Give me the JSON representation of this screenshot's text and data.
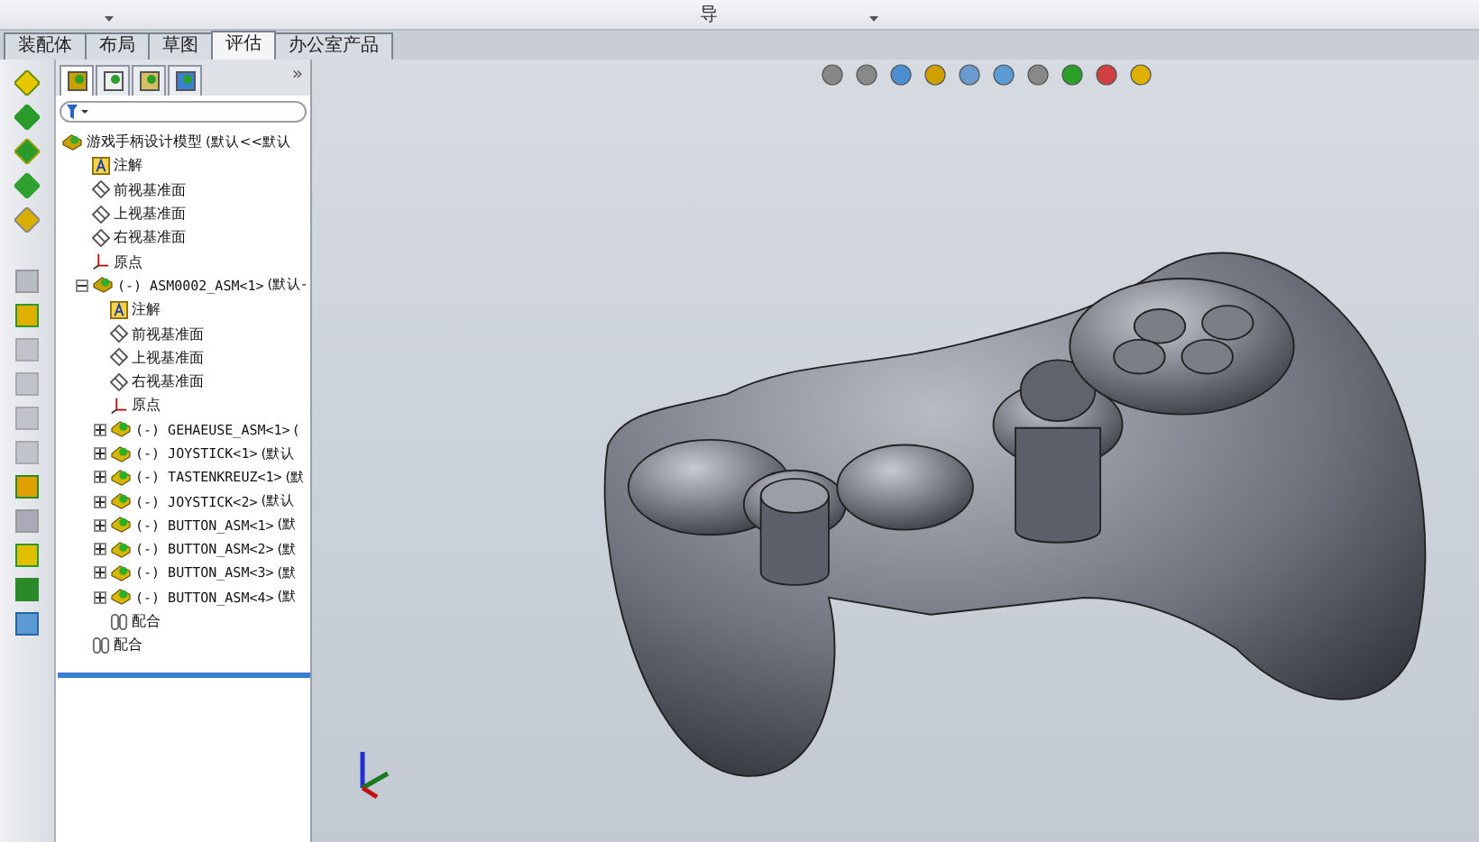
{
  "ribbon": {
    "visible_text": "导"
  },
  "tabs": [
    {
      "label": "装配体",
      "selected": false
    },
    {
      "label": "布局",
      "selected": false
    },
    {
      "label": "草图",
      "selected": false
    },
    {
      "label": "评估",
      "selected": true
    },
    {
      "label": "办公室产品",
      "selected": false
    }
  ],
  "panel_tabs": [
    {
      "kind": "feature",
      "selected": true
    },
    {
      "kind": "property",
      "selected": false
    },
    {
      "kind": "config",
      "selected": false
    },
    {
      "kind": "display",
      "selected": false
    }
  ],
  "panel_more": "»",
  "tree": [
    {
      "kind": "assembly",
      "label": "游戏手柄设计模型",
      "suffix": "(默认<<默认",
      "children": [
        {
          "kind": "annotation",
          "label": "注解"
        },
        {
          "kind": "plane",
          "label": "前视基准面"
        },
        {
          "kind": "plane",
          "label": "上视基准面"
        },
        {
          "kind": "plane",
          "label": "右视基准面"
        },
        {
          "kind": "origin",
          "label": "原点"
        },
        {
          "kind": "assembly",
          "label": "(-) ASM0002_ASM<1>",
          "suffix": "(默认-",
          "expanded": true,
          "children": [
            {
              "kind": "annotation",
              "label": "注解"
            },
            {
              "kind": "plane",
              "label": "前视基准面"
            },
            {
              "kind": "plane",
              "label": "上视基准面"
            },
            {
              "kind": "plane",
              "label": "右视基准面"
            },
            {
              "kind": "origin",
              "label": "原点"
            },
            {
              "kind": "part",
              "label": "(-) GEHAEUSE_ASM<1>",
              "suffix": "(",
              "expanded": false
            },
            {
              "kind": "part",
              "label": "(-) JOYSTICK<1>",
              "suffix": "(默认",
              "expanded": false
            },
            {
              "kind": "part",
              "label": "(-) TASTENKREUZ<1>",
              "suffix": "(默",
              "expanded": false
            },
            {
              "kind": "part",
              "label": "(-) JOYSTICK<2>",
              "suffix": "(默认",
              "expanded": false
            },
            {
              "kind": "part",
              "label": "(-) BUTTON_ASM<1>",
              "suffix": "(默",
              "expanded": false
            },
            {
              "kind": "part",
              "label": "(-) BUTTON_ASM<2>",
              "suffix": "(默",
              "expanded": false
            },
            {
              "kind": "part",
              "label": "(-) BUTTON_ASM<3>",
              "suffix": "(默",
              "expanded": false
            },
            {
              "kind": "part",
              "label": "(-) BUTTON_ASM<4>",
              "suffix": "(默",
              "expanded": false
            },
            {
              "kind": "mates",
              "label": "配合"
            }
          ]
        },
        {
          "kind": "mates",
          "label": "配合"
        }
      ]
    }
  ]
}
